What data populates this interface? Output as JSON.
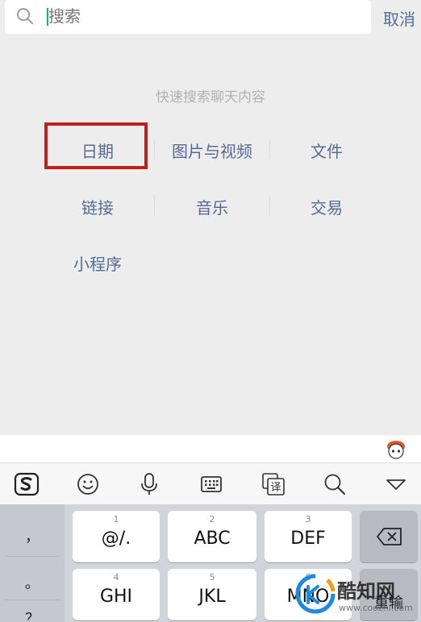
{
  "search": {
    "placeholder": "搜索",
    "cancel_label": "取消"
  },
  "quick_search": {
    "title": "快速搜索聊天内容",
    "categories": [
      "日期",
      "图片与视频",
      "文件",
      "链接",
      "音乐",
      "交易",
      "小程序"
    ]
  },
  "keyboard": {
    "toolbar_icons": [
      "sogou-logo-icon",
      "emoji-icon",
      "microphone-icon",
      "keyboard-icon",
      "translate-icon",
      "search-icon",
      "collapse-icon"
    ],
    "translate_glyph": "译",
    "punctuation": [
      "，",
      "。",
      "？"
    ],
    "keys": [
      {
        "number": "1",
        "label": "@/."
      },
      {
        "number": "2",
        "label": "ABC"
      },
      {
        "number": "3",
        "label": "DEF"
      },
      {
        "number": "4",
        "label": "GHI"
      },
      {
        "number": "5",
        "label": "JKL"
      },
      {
        "number": "6",
        "label": "MNO"
      }
    ],
    "delete_icon": "backspace-icon"
  },
  "watermark": {
    "text": "酷知网",
    "url": "www.coozhi.com",
    "partial_key_label": "重输"
  },
  "colors": {
    "link": "#576b95",
    "highlight_box": "#c0201b",
    "caret": "#07c160"
  }
}
